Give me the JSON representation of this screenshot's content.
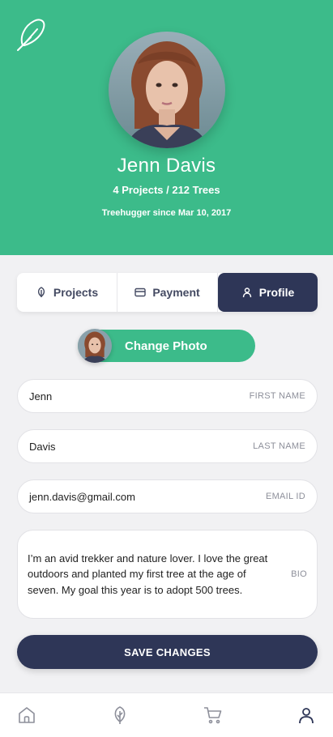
{
  "header": {
    "logo_icon": "feather-leaf-icon",
    "name": "Jenn Davis",
    "stats": "4 Projects / 212 Trees",
    "since": "Treehugger since Mar 10, 2017"
  },
  "tabs": [
    {
      "label": "Projects",
      "icon": "leaf-icon",
      "active": false
    },
    {
      "label": "Payment",
      "icon": "card-icon",
      "active": false
    },
    {
      "label": "Profile",
      "icon": "person-icon",
      "active": true
    }
  ],
  "change_photo": {
    "label": "Change Photo"
  },
  "form": {
    "first_name": {
      "value": "Jenn",
      "label": "FIRST NAME"
    },
    "last_name": {
      "value": "Davis",
      "label": "LAST NAME"
    },
    "email": {
      "value": "jenn.davis@gmail.com",
      "label": "EMAIL ID"
    },
    "bio": {
      "value": "I’m an avid trekker and nature lover. I love the great outdoors and planted my first tree at the age of seven. My goal this year is to adopt 500 trees.",
      "label": "BIO"
    }
  },
  "save_label": "SAVE CHANGES",
  "bottom_nav": [
    {
      "icon": "home-icon"
    },
    {
      "icon": "leaf-icon"
    },
    {
      "icon": "cart-icon"
    },
    {
      "icon": "person-icon"
    }
  ],
  "colors": {
    "brand_green": "#3cbb8a",
    "navy": "#2e3657",
    "background": "#f1f1f3"
  }
}
